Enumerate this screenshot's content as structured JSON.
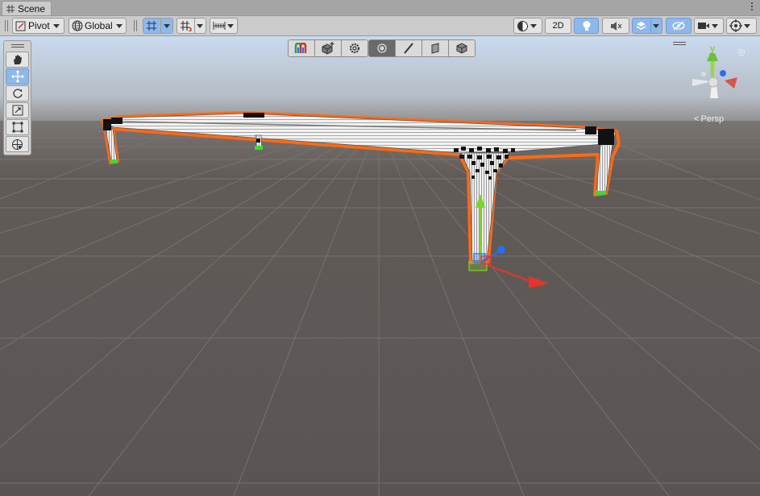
{
  "window": {
    "tab_label": "Scene",
    "tab_icon": "grid-icon",
    "menu_icon": "kebab-icon"
  },
  "toolbar": {
    "pivot_label": "Pivot",
    "global_label": "Global",
    "mode_2d_label": "2D",
    "icons": [
      "pivot-icon",
      "globe-icon",
      "grid-snap-icon",
      "snap-increment-icon",
      "ruler-icon",
      "shading-icon",
      "light-icon",
      "audio-mute-icon",
      "effects-icon",
      "visibility-icon",
      "camera-icon",
      "gizmos-icon"
    ]
  },
  "palette": {
    "tools": [
      "hand-tool",
      "move-tool",
      "rotate-tool",
      "scale-tool",
      "rect-tool",
      "transform-tool"
    ],
    "active_tool": "move-tool"
  },
  "overlay_toolbar": {
    "tools": [
      "probuilder-icon",
      "add-object-icon",
      "settings-gear-icon",
      "vertex-mode-icon",
      "edge-mode-icon",
      "face-mode-icon",
      "object-mode-icon"
    ],
    "active_tool": "vertex-mode-icon"
  },
  "gizmo": {
    "y_axis_label": "y",
    "projection_label": "Persp"
  },
  "colors": {
    "sky": "#c7d8ea",
    "ground": "#5e5856",
    "selection_outline": "#ff6a14",
    "axis_x": "#e8332a",
    "axis_y": "#7fd32c",
    "axis_z": "#2d6cf0",
    "active_button": "#8fb8ea"
  }
}
